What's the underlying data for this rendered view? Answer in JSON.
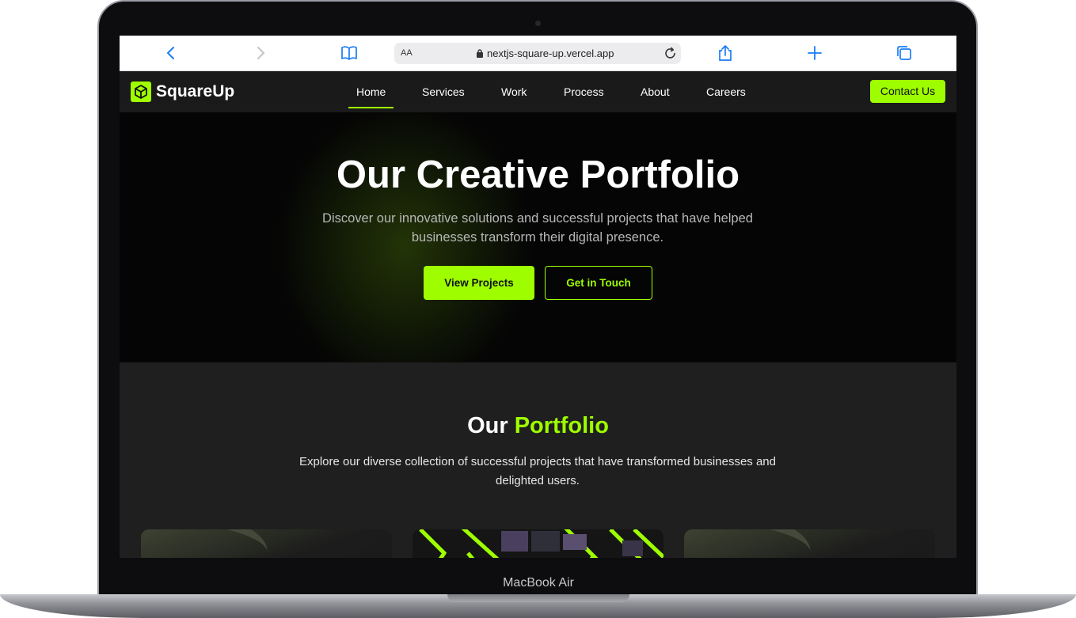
{
  "device": {
    "label": "MacBook Air"
  },
  "browser": {
    "text_size_label": "AA",
    "url": "nextjs-square-up.vercel.app"
  },
  "site": {
    "logo": "SquareUp",
    "nav": [
      {
        "label": "Home",
        "active": true
      },
      {
        "label": "Services"
      },
      {
        "label": "Work"
      },
      {
        "label": "Process"
      },
      {
        "label": "About"
      },
      {
        "label": "Careers"
      }
    ],
    "contact_label": "Contact Us"
  },
  "hero": {
    "title": "Our Creative Portfolio",
    "subtitle": "Discover our innovative solutions and successful projects that have helped businesses transform their digital presence.",
    "primary_label": "View Projects",
    "secondary_label": "Get in Touch"
  },
  "portfolio": {
    "title_plain": "Our",
    "title_accent": "Portfolio",
    "subtitle": "Explore our diverse collection of successful projects that have transformed businesses and delighted users."
  },
  "colors": {
    "accent": "#9efe00",
    "nav_bg": "#1a1a1a",
    "hero_bg": "#050505",
    "section_bg": "#1f1f1f"
  }
}
